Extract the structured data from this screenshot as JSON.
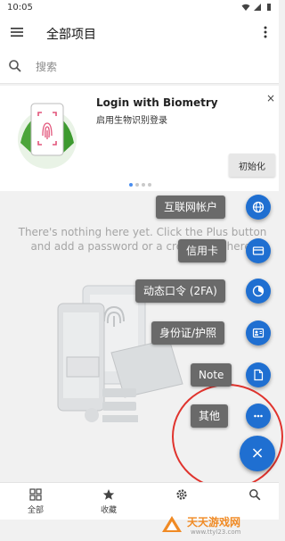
{
  "status_bar": {
    "time": "10:05"
  },
  "app_bar": {
    "title": "全部项目"
  },
  "search": {
    "placeholder": "搜索"
  },
  "promo_card": {
    "title": "Login with Biometry",
    "subtitle": "启用生物识别登录",
    "action_label": "初始化",
    "dots_count": 4,
    "active_dot": 0
  },
  "empty_state": {
    "message": "There's nothing here yet. Click the Plus button and add a password or a credit card here."
  },
  "fab_menu": {
    "items": [
      {
        "label": "互联网帐户",
        "icon": "globe-icon"
      },
      {
        "label": "信用卡",
        "icon": "credit-card-icon"
      },
      {
        "label": "动态口令 (2FA)",
        "icon": "timer-icon"
      },
      {
        "label": "身份证/护照",
        "icon": "id-card-icon"
      },
      {
        "label": "Note",
        "icon": "note-icon"
      },
      {
        "label": "其他",
        "icon": "more-horiz-icon"
      }
    ],
    "close_symbol": "×",
    "accent": "#1f6fd1"
  },
  "bottom_nav": {
    "items": [
      {
        "label": "全部",
        "icon": "grid-icon"
      },
      {
        "label": "收藏",
        "icon": "star-icon"
      },
      {
        "label": "",
        "icon": "settings-icon"
      },
      {
        "label": "",
        "icon": "search-icon"
      }
    ]
  },
  "watermark": {
    "brand": "天天游戏网",
    "url": "www.ttyl23.com"
  }
}
